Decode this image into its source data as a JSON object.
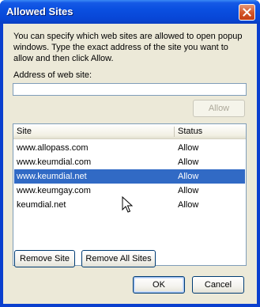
{
  "window": {
    "title": "Allowed Sites"
  },
  "dialog": {
    "description": "You can specify which web sites are allowed to open popup windows. Type the exact address of the site you want to allow and then click Allow.",
    "address_label": "Address of web site:",
    "address_value": "",
    "allow_label": "Allow"
  },
  "table": {
    "columns": [
      "Site",
      "Status"
    ],
    "rows": [
      {
        "site": "www.allopass.com",
        "status": "Allow",
        "selected": false
      },
      {
        "site": "www.keumdial.com",
        "status": "Allow",
        "selected": false
      },
      {
        "site": "www.keumdial.net",
        "status": "Allow",
        "selected": true
      },
      {
        "site": "www.keumgay.com",
        "status": "Allow",
        "selected": false
      },
      {
        "site": "keumdial.net",
        "status": "Allow",
        "selected": false
      }
    ]
  },
  "buttons": {
    "remove_site": "Remove Site",
    "remove_all_sites": "Remove All Sites",
    "ok": "OK",
    "cancel": "Cancel"
  },
  "icons": {
    "close": "close-icon",
    "cursor": "mouse-pointer-icon"
  },
  "colors": {
    "titlebar": "#0a4fe0",
    "selection": "#316ac5",
    "dialog_bg": "#ece9d8",
    "close_button": "#d5582c"
  }
}
